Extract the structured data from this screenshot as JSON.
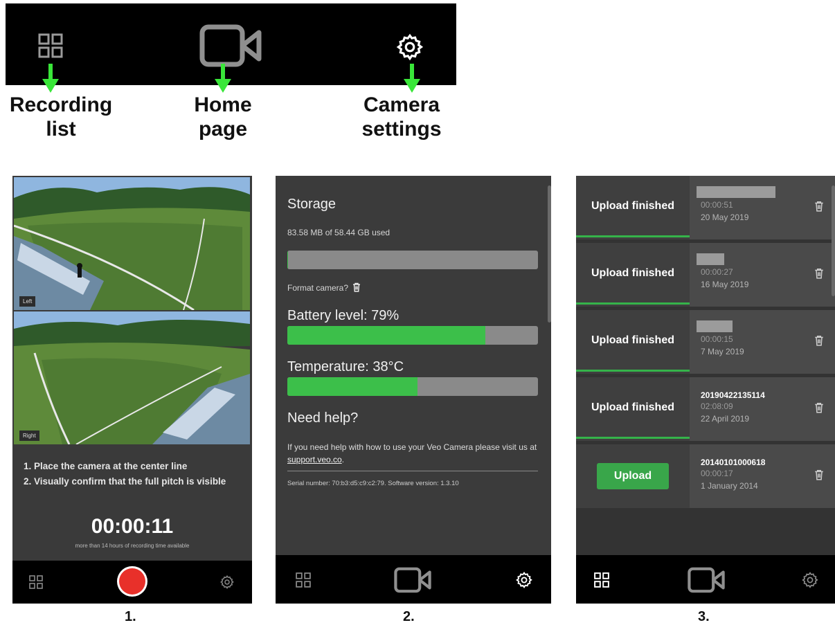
{
  "legend": {
    "items": [
      {
        "icon": "grid-icon",
        "label": "Recording\nlist"
      },
      {
        "icon": "video-camera-icon",
        "label": "Home\npage"
      },
      {
        "icon": "gear-icon",
        "label": "Camera\nsettings"
      }
    ],
    "arrow_color": "#39e639"
  },
  "steps": [
    "1.",
    "2.",
    "3."
  ],
  "panel1": {
    "tag_left": "Left",
    "tag_right": "Right",
    "instructions": [
      "1. Place the camera at the center line",
      "2. Visually confirm that the full pitch is visible"
    ],
    "timer": "00:00:11",
    "timer_sub": "more than 14 hours of recording time available",
    "record_color": "#e8302a"
  },
  "panel2": {
    "storage_title": "Storage",
    "storage_used": "83.58 MB of 58.44 GB used",
    "storage_fraction": 0.0014,
    "format_label": "Format camera?",
    "battery_label": "Battery level: 79%",
    "battery_fraction": 0.79,
    "temp_label": "Temperature: 38°C",
    "temp_fraction": 0.52,
    "help_title": "Need help?",
    "help_text": "If you need help with how to use your Veo Camera please visit us at ",
    "help_link": "support.veo.co",
    "help_end": ".",
    "serial": "Serial number: 70:b3:d5:c9:c2:79. Software version: 1.3.10"
  },
  "panel3": {
    "recordings": [
      {
        "status": "Upload finished",
        "title": "",
        "duration": "00:00:51",
        "date": "20 May 2019",
        "upload_button": false
      },
      {
        "status": "Upload finished",
        "title": "",
        "duration": "00:00:27",
        "date": "16 May 2019",
        "upload_button": false
      },
      {
        "status": "Upload finished",
        "title": "",
        "duration": "00:00:15",
        "date": "7 May 2019",
        "upload_button": false
      },
      {
        "status": "Upload finished",
        "title": "20190422135114",
        "duration": "02:08:09",
        "date": "22 April 2019",
        "upload_button": false
      },
      {
        "status": "",
        "title": "20140101000618",
        "duration": "00:00:17",
        "date": "1 January 2014",
        "upload_button": true,
        "button_label": "Upload"
      }
    ]
  }
}
